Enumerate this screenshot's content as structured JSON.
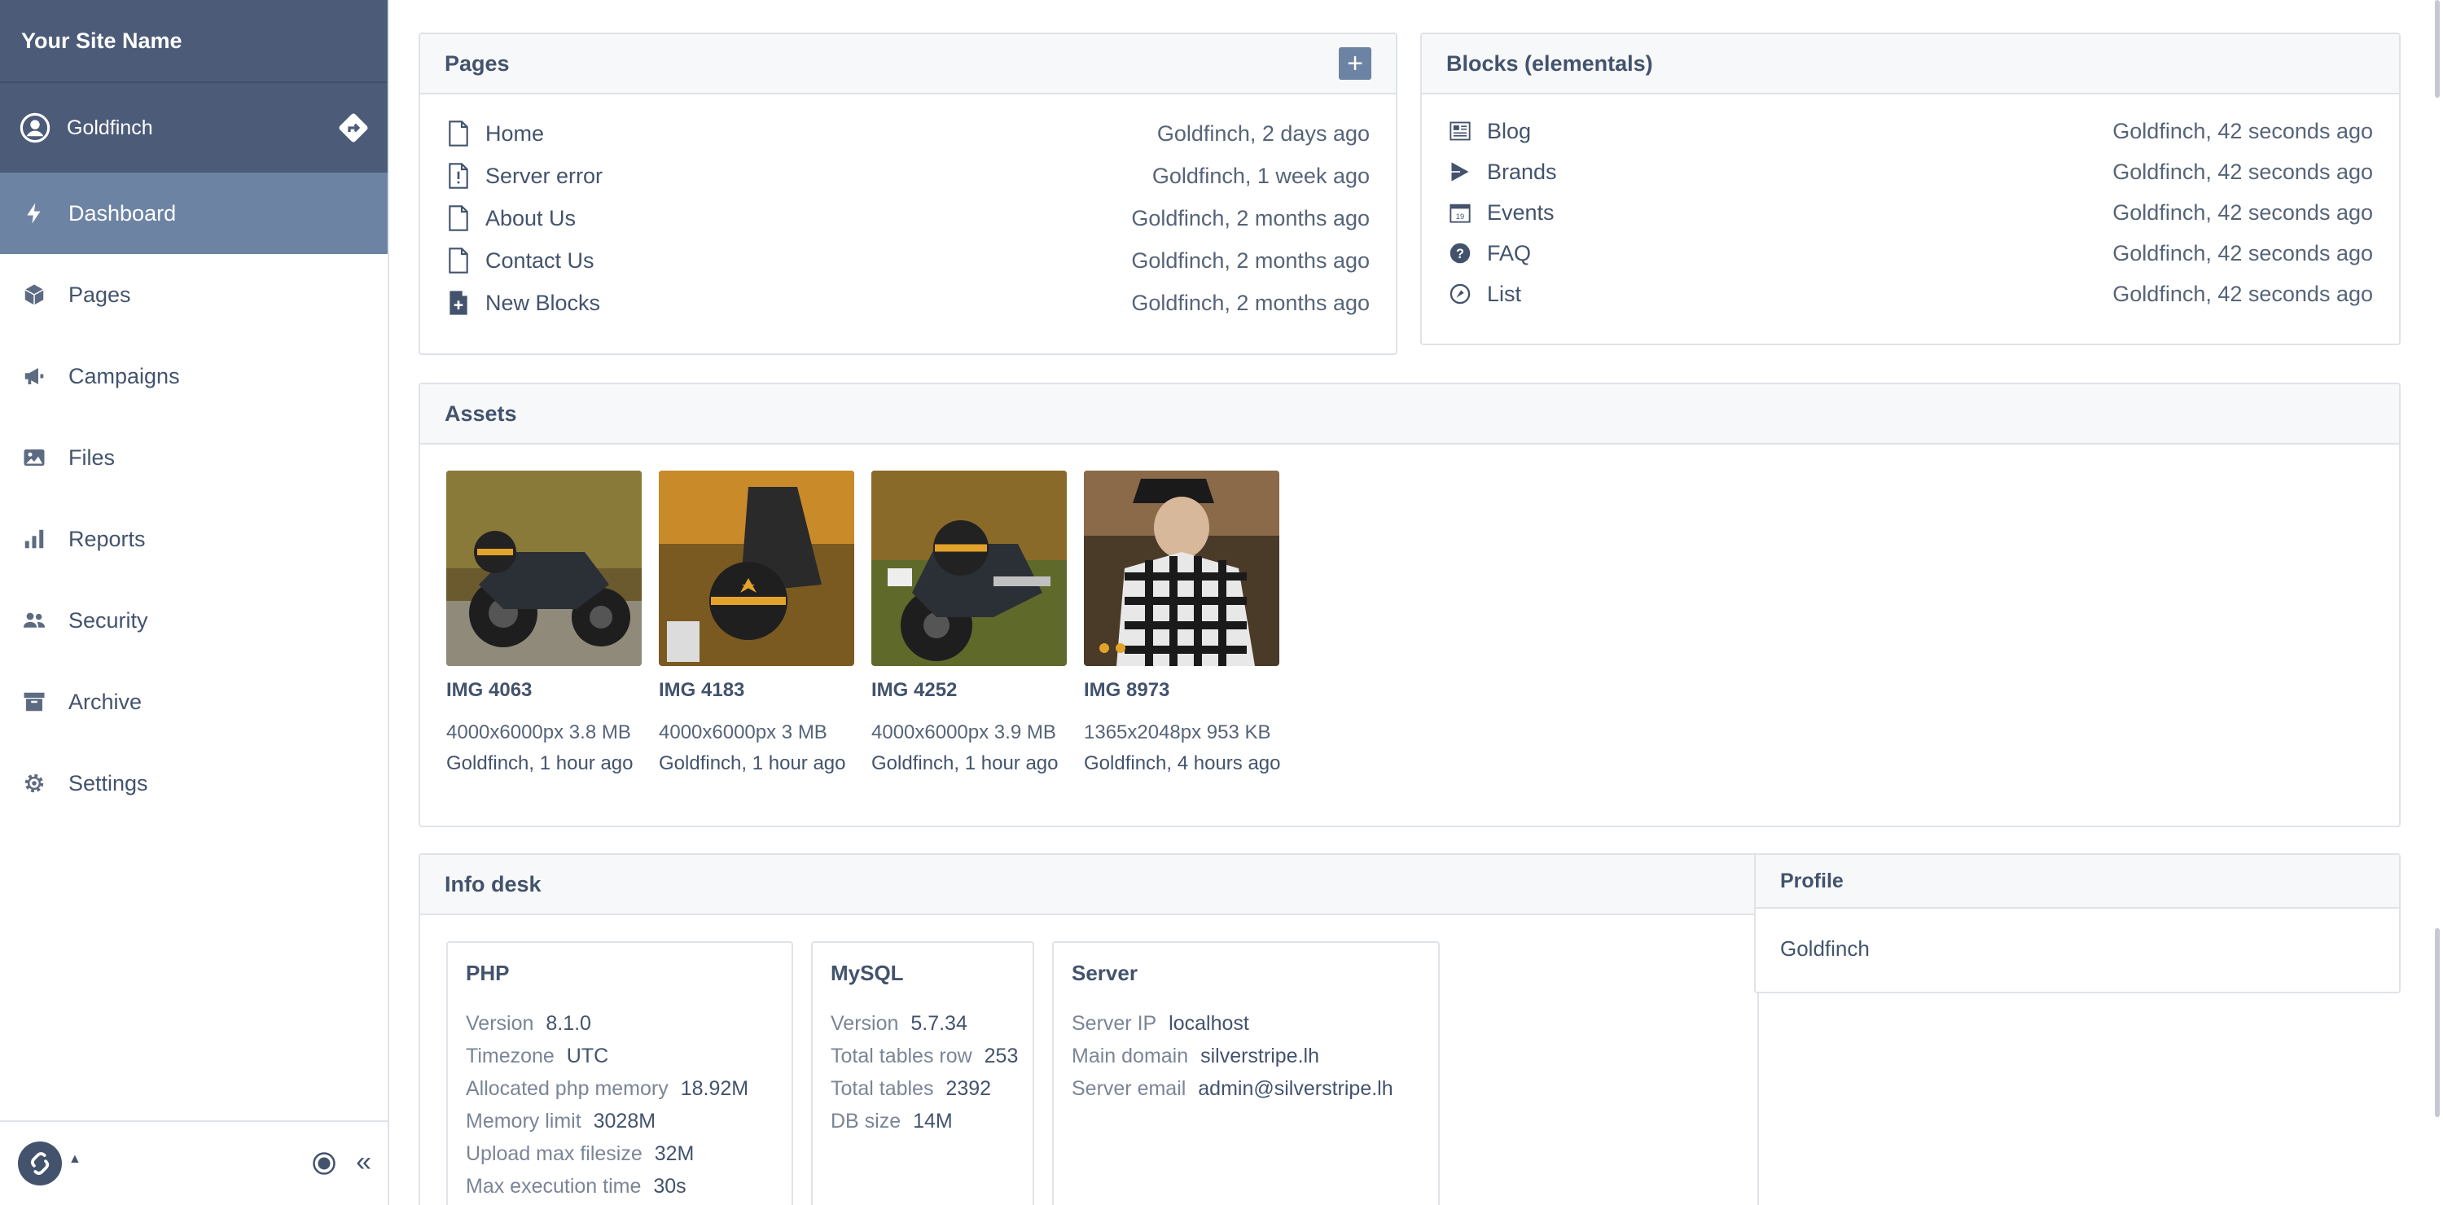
{
  "sidebar": {
    "site_name": "Your Site Name",
    "user": {
      "name": "Goldfinch"
    },
    "items": [
      {
        "label": "Dashboard",
        "icon": "lightning-icon",
        "active": true
      },
      {
        "label": "Pages",
        "icon": "cube-icon"
      },
      {
        "label": "Campaigns",
        "icon": "megaphone-icon"
      },
      {
        "label": "Files",
        "icon": "image-icon"
      },
      {
        "label": "Reports",
        "icon": "bar-chart-icon"
      },
      {
        "label": "Security",
        "icon": "users-icon"
      },
      {
        "label": "Archive",
        "icon": "archive-box-icon"
      },
      {
        "label": "Settings",
        "icon": "gear-icon"
      }
    ],
    "collapse_label": "«"
  },
  "pages_panel": {
    "title": "Pages",
    "add_label": "+",
    "rows": [
      {
        "title": "Home",
        "meta": "Goldfinch, 2 days ago",
        "icon": "page-icon"
      },
      {
        "title": "Server error",
        "meta": "Goldfinch, 1 week ago",
        "icon": "page-error-icon"
      },
      {
        "title": "About Us",
        "meta": "Goldfinch, 2 months ago",
        "icon": "page-icon"
      },
      {
        "title": "Contact Us",
        "meta": "Goldfinch, 2 months ago",
        "icon": "page-icon"
      },
      {
        "title": "New Blocks",
        "meta": "Goldfinch, 2 months ago",
        "icon": "page-blocks-icon"
      }
    ]
  },
  "blocks_panel": {
    "title": "Blocks (elementals)",
    "rows": [
      {
        "title": "Blog",
        "meta": "Goldfinch, 42 seconds ago",
        "icon": "newspaper-icon"
      },
      {
        "title": "Brands",
        "meta": "Goldfinch, 42 seconds ago",
        "icon": "play-brand-icon"
      },
      {
        "title": "Events",
        "meta": "Goldfinch, 42 seconds ago",
        "icon": "calendar-icon"
      },
      {
        "title": "FAQ",
        "meta": "Goldfinch, 42 seconds ago",
        "icon": "question-icon"
      },
      {
        "title": "List",
        "meta": "Goldfinch, 42 seconds ago",
        "icon": "list-refresh-icon"
      }
    ]
  },
  "assets_panel": {
    "title": "Assets",
    "items": [
      {
        "name": "IMG 4063",
        "dims": "4000x6000px 3.8 MB",
        "by": "Goldfinch, 1 hour ago"
      },
      {
        "name": "IMG 4183",
        "dims": "4000x6000px 3 MB",
        "by": "Goldfinch, 1 hour ago"
      },
      {
        "name": "IMG 4252",
        "dims": "4000x6000px 3.9 MB",
        "by": "Goldfinch, 1 hour ago"
      },
      {
        "name": "IMG 8973",
        "dims": "1365x2048px 953 KB",
        "by": "Goldfinch, 4 hours ago"
      }
    ]
  },
  "info_panel": {
    "title": "Info desk",
    "php": {
      "title": "PHP",
      "rows": [
        {
          "k": "Version",
          "v": "8.1.0"
        },
        {
          "k": "Timezone",
          "v": "UTC"
        },
        {
          "k": "Allocated php memory",
          "v": "18.92M"
        },
        {
          "k": "Memory limit",
          "v": "3028M"
        },
        {
          "k": "Upload max filesize",
          "v": "32M"
        },
        {
          "k": "Max execution time",
          "v": "30s"
        }
      ]
    },
    "mysql": {
      "title": "MySQL",
      "rows": [
        {
          "k": "Version",
          "v": "5.7.34"
        },
        {
          "k": "Total tables row",
          "v": "253"
        },
        {
          "k": "Total tables",
          "v": "2392"
        },
        {
          "k": "DB size",
          "v": "14M"
        }
      ]
    },
    "server": {
      "title": "Server",
      "rows": [
        {
          "k": "Server IP",
          "v": "localhost"
        },
        {
          "k": "Main domain",
          "v": "silverstripe.lh"
        },
        {
          "k": "Server email",
          "v": "admin@silverstripe.lh"
        }
      ]
    }
  },
  "profile_panel": {
    "title": "Profile",
    "name": "Goldfinch"
  },
  "colors": {
    "sidebar_header": "#4b5b78",
    "active_nav": "#6d83a3",
    "text": "#43536d",
    "border": "#dfe3e8"
  }
}
